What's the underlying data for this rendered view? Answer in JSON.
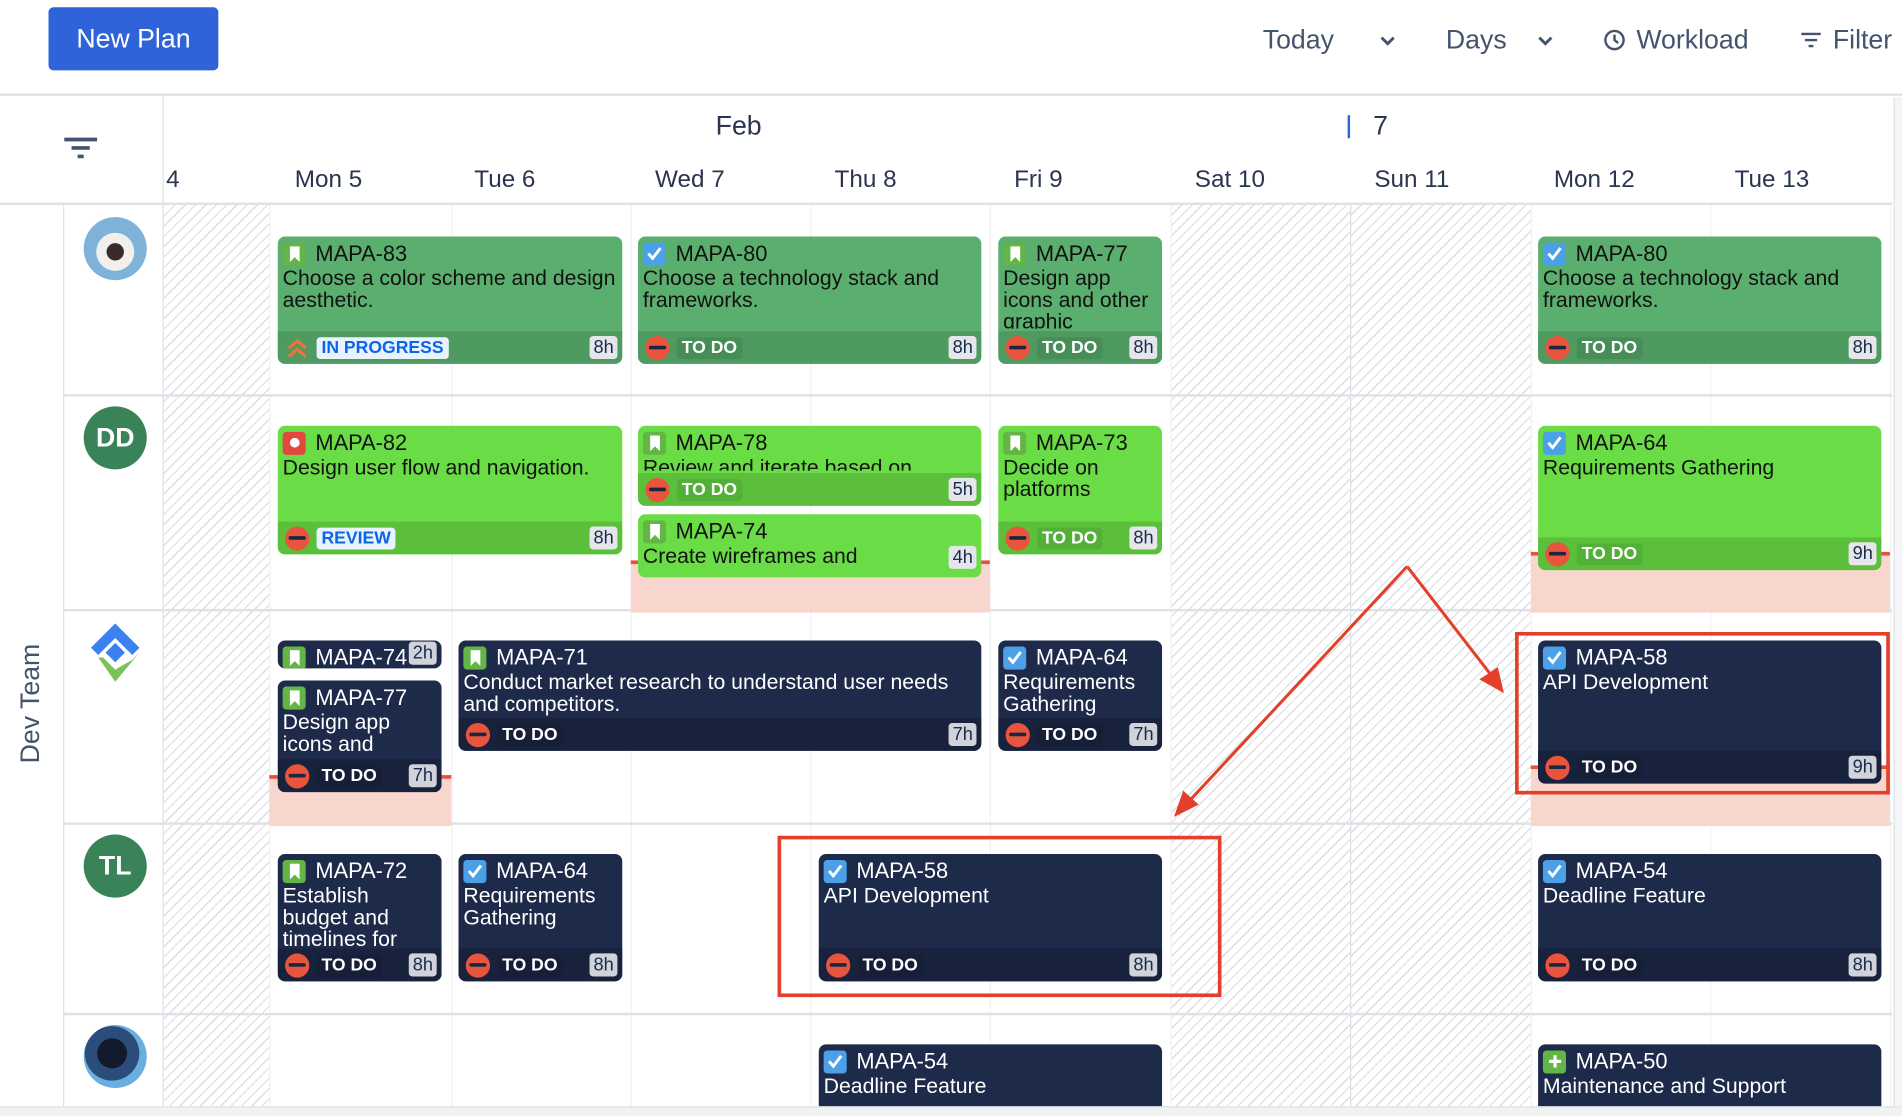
{
  "toolbar": {
    "new_plan": "New Plan",
    "today": "Today",
    "days": "Days",
    "workload": "Workload",
    "filter": "Filter"
  },
  "timeline": {
    "month": "Feb",
    "week_marker": "7",
    "days": [
      "4",
      "Mon 5",
      "Tue 6",
      "Wed 7",
      "Thu 8",
      "Fri 9",
      "Sat 10",
      "Sun 11",
      "Mon 12",
      "Tue 13"
    ]
  },
  "team": {
    "name": "Dev Team"
  },
  "colors": {
    "accent": "#2f63d9",
    "row_green": "#5aaf6e",
    "row_lime": "#6adc46",
    "row_navy": "#1e2a4a",
    "annotation": "#e3402a",
    "overload": "#f9d6cd"
  },
  "rows": [
    {
      "assignee": "photo-avatar-1",
      "initials": "",
      "cards": [
        {
          "key": "MAPA-83",
          "summary": "Choose a color scheme and design aesthetic.",
          "status": "IN PROGRESS",
          "hours": "8h",
          "type": "story-bookmark-icon",
          "priority": "high"
        },
        {
          "key": "MAPA-80",
          "summary": "Choose a technology stack and frameworks.",
          "status": "TO DO",
          "hours": "8h",
          "type": "task-check-icon"
        },
        {
          "key": "MAPA-77",
          "summary": "Design app icons and other graphic",
          "status": "TO DO",
          "hours": "8h",
          "type": "story-bookmark-icon"
        },
        {
          "key": "MAPA-80",
          "summary": "Choose a technology stack and frameworks.",
          "status": "TO DO",
          "hours": "8h",
          "type": "task-check-icon"
        }
      ]
    },
    {
      "assignee": "initials-avatar",
      "initials": "DD",
      "cards": [
        {
          "key": "MAPA-82",
          "summary": "Design user flow and navigation.",
          "status": "REVIEW",
          "hours": "8h",
          "type": "bug-icon"
        },
        {
          "key": "MAPA-78",
          "summary": "Review and iterate based on",
          "status": "TO DO",
          "hours": "5h",
          "type": "story-bookmark-icon"
        },
        {
          "key": "MAPA-74",
          "summary": "Create wireframes and",
          "status": "",
          "hours": "4h",
          "type": "story-bookmark-icon"
        },
        {
          "key": "MAPA-73",
          "summary": "Decide on platforms",
          "status": "TO DO",
          "hours": "8h",
          "type": "story-bookmark-icon"
        },
        {
          "key": "MAPA-64",
          "summary": "Requirements Gathering",
          "status": "TO DO",
          "hours": "9h",
          "type": "task-check-icon"
        }
      ]
    },
    {
      "assignee": "logo-avatar",
      "initials": "",
      "cards": [
        {
          "key": "MAPA-74",
          "summary": "",
          "status": "",
          "hours": "2h",
          "type": "story-bookmark-icon"
        },
        {
          "key": "MAPA-77",
          "summary": "Design app icons and",
          "status": "TO DO",
          "hours": "7h",
          "type": "story-bookmark-icon"
        },
        {
          "key": "MAPA-71",
          "summary": "Conduct market research to understand user needs and competitors.",
          "status": "TO DO",
          "hours": "7h",
          "type": "story-bookmark-icon"
        },
        {
          "key": "MAPA-64",
          "summary": "Requirements Gathering",
          "status": "TO DO",
          "hours": "7h",
          "type": "task-check-icon"
        },
        {
          "key": "MAPA-58",
          "summary": "API Development",
          "status": "TO DO",
          "hours": "9h",
          "type": "task-check-icon"
        }
      ]
    },
    {
      "assignee": "initials-avatar",
      "initials": "TL",
      "cards": [
        {
          "key": "MAPA-72",
          "summary": "Establish budget and timelines for",
          "status": "TO DO",
          "hours": "8h",
          "type": "story-bookmark-icon"
        },
        {
          "key": "MAPA-64",
          "summary": "Requirements Gathering",
          "status": "TO DO",
          "hours": "8h",
          "type": "task-check-icon"
        },
        {
          "key": "MAPA-58",
          "summary": "API Development",
          "status": "TO DO",
          "hours": "8h",
          "type": "task-check-icon"
        },
        {
          "key": "MAPA-54",
          "summary": "Deadline Feature",
          "status": "TO DO",
          "hours": "8h",
          "type": "task-check-icon"
        }
      ]
    },
    {
      "assignee": "photo-avatar-2",
      "initials": "",
      "cards": [
        {
          "key": "MAPA-54",
          "summary": "Deadline Feature",
          "status": "",
          "hours": "",
          "type": "task-check-icon"
        },
        {
          "key": "MAPA-50",
          "summary": "Maintenance and Support",
          "status": "",
          "hours": "",
          "type": "improvement-plus-icon"
        }
      ]
    }
  ]
}
